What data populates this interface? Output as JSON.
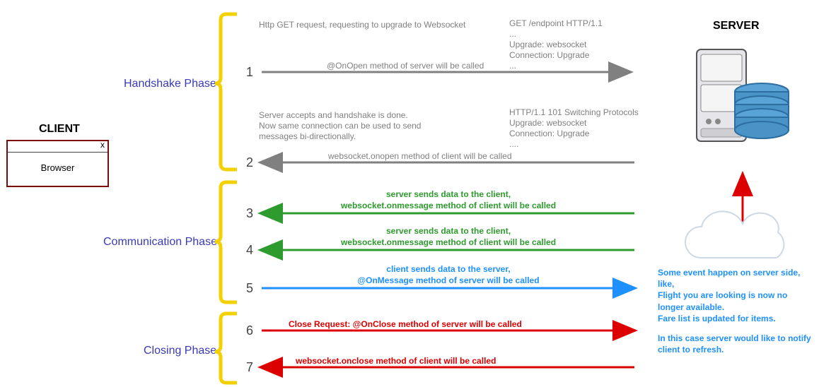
{
  "titles": {
    "client": "CLIENT",
    "server": "SERVER",
    "browser": "Browser",
    "close_x": "x"
  },
  "phases": {
    "handshake": "Handshake Phase",
    "communication": "Communication Phase",
    "closing": "Closing Phase"
  },
  "steps": {
    "s1": {
      "num": "1",
      "top": "Http GET request, requesting to upgrade to Websocket",
      "mid": "@OnOpen method of server will be called",
      "headers": "GET /endpoint HTTP/1.1\n...\nUpgrade: websocket\nConnection: Upgrade\n..."
    },
    "s2": {
      "num": "2",
      "top": "Server accepts and handshake is done.\nNow same connection can be used to send\nmessages bi-directionally.",
      "mid": "websocket.onopen method of client will be called",
      "headers": "HTTP/1.1 101 Switching Protocols\nUpgrade: websocket\nConnection: Upgrade\n...."
    },
    "s3": {
      "num": "3",
      "top": "server sends data to the client,",
      "mid": "websocket.onmessage method of client will be called"
    },
    "s4": {
      "num": "4",
      "top": "server sends data to the client,",
      "mid": "websocket.onmessage method of client will be called"
    },
    "s5": {
      "num": "5",
      "top": "client sends data to the server,",
      "mid": "@OnMessage method of server will be called"
    },
    "s6": {
      "num": "6",
      "mid": "Close Request: @OnClose method of server will be called"
    },
    "s7": {
      "num": "7",
      "mid": "websocket.onclose method of client will be called"
    }
  },
  "note": {
    "line1": "Some event happen on server side, like,",
    "line2": "Flight you are looking is now no longer available.",
    "line3": "Fare list is updated for items.",
    "line4": "In this case server would like to notify client to refresh."
  }
}
